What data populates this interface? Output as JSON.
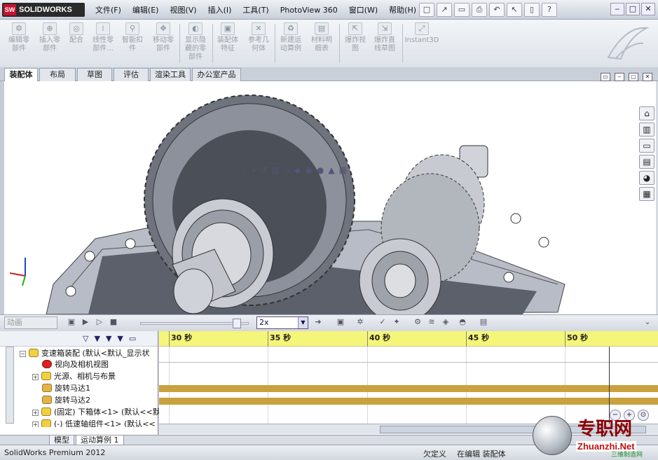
{
  "app": {
    "logo_mark": "SW",
    "logo_text": "SOLIDWORKS"
  },
  "menu": [
    "文件(F)",
    "编辑(E)",
    "视图(V)",
    "插入(I)",
    "工具(T)",
    "PhotoView 360",
    "窗口(W)",
    "帮助(H)"
  ],
  "quick_access": [
    "□",
    "↗",
    "▭",
    "⎙",
    "↶",
    "↖",
    "▯",
    "?",
    "‒",
    "□",
    "✕"
  ],
  "command_bar": [
    {
      "label_line1": "编辑零",
      "label_line2": "部件",
      "icon": "edit-component-icon"
    },
    {
      "label_line1": "插入零",
      "label_line2": "部件",
      "icon": "insert-component-icon"
    },
    {
      "label_line1": "配合",
      "label_line2": "",
      "icon": "mate-icon"
    },
    {
      "label_line1": "线性零",
      "label_line2": "部件...",
      "icon": "linear-pattern-icon"
    },
    {
      "label_line1": "智能扣",
      "label_line2": "件",
      "icon": "smart-fastener-icon"
    },
    {
      "label_line1": "移动零",
      "label_line2": "部件",
      "icon": "move-component-icon"
    },
    {
      "label_line1": "显示隐",
      "label_line2": "藏的零",
      "label_line3": "部件",
      "icon": "show-hidden-icon"
    },
    {
      "label_line1": "装配体",
      "label_line2": "特征",
      "icon": "assembly-feature-icon"
    },
    {
      "label_line1": "参考几",
      "label_line2": "何体",
      "icon": "reference-geometry-icon"
    },
    {
      "label_line1": "新建运",
      "label_line2": "动算例",
      "icon": "new-motion-study-icon"
    },
    {
      "label_line1": "材料明",
      "label_line2": "细表",
      "icon": "bom-icon"
    },
    {
      "label_line1": "爆炸视",
      "label_line2": "图",
      "icon": "exploded-view-icon"
    },
    {
      "label_line1": "爆炸直",
      "label_line2": "线草图",
      "icon": "explode-line-sketch-icon"
    },
    {
      "label_line1": "Instant3D",
      "label_line2": "",
      "icon": "instant3d-icon"
    }
  ],
  "tabs": [
    "装配体",
    "布局",
    "草图",
    "评估",
    "渲染工具",
    "办公室产品"
  ],
  "motion": {
    "study_type": "动画",
    "playback_speed": "2x",
    "ruler_ticks": [
      "30 秒",
      "35 秒",
      "40 秒",
      "45 秒",
      "50 秒"
    ]
  },
  "tree": [
    {
      "label": "变速箱装配  (默认<默认_显示状",
      "expand": "−",
      "icon": "assembly-icon"
    },
    {
      "label": "视向及相机视图",
      "icon": "camera-views-icon"
    },
    {
      "label": "光源、相机与布景",
      "expand": "+",
      "icon": "lights-icon"
    },
    {
      "label": "旋转马达1",
      "icon": "rotary-motor-icon"
    },
    {
      "label": "旋转马达2",
      "icon": "rotary-motor-icon"
    },
    {
      "label": "(固定) 下箱体<1> (默认<<默",
      "expand": "+",
      "icon": "part-icon"
    },
    {
      "label": "(-) 低速轴组件<1> (默认<<",
      "expand": "+",
      "icon": "part-icon"
    }
  ],
  "bottom_tabs": [
    "模型",
    "运动算例 1"
  ],
  "status": {
    "product": "SolidWorks Premium 2012",
    "state": "欠定义",
    "editing": "在编辑 装配体"
  },
  "watermark": {
    "cn": "专职网",
    "en": "Zhuanzhi.Net",
    "sub": "三维制造网"
  },
  "colors": {
    "timeline_ruler": "#f5f57a",
    "motor_bar": "#c9a23f",
    "logo_red": "#c8102e"
  }
}
